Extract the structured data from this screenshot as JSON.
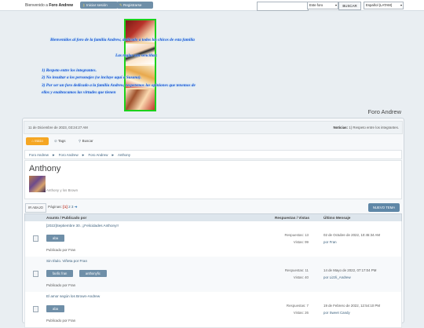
{
  "topbar": {
    "welcome_prefix": "Bienvenido a",
    "welcome_forum": "Foro Andrew",
    "login_label": "Iniciar sesión",
    "register_label": "Registrarse",
    "search_placeholder": "",
    "scope_value": "Este foro",
    "search_button": "BUSCAR",
    "language_value": "Español (LATAM)"
  },
  "banner": {
    "line1": "Bienvenidos al foro de la familia Andrew, dedicado a todos los chicos de esta familia",
    "line2": "Las reglas son sencillas:",
    "line3": "1) Respeto entre los integrantes.",
    "line4": "2) No insultar a los personajes (se incluye aquí a Susana).",
    "line5": "3) Por ser un foro dedicado a la familia Andrew, respetemos las opiniones que tenemos de",
    "line6": "ellos y enaltezcamos las virtudes que tienen",
    "forum_name": "Foro Andrew"
  },
  "info": {
    "date": "11 de Diciembre de 2023, 03:24:27 AM",
    "news_label": "Noticias:",
    "news_text": "1) Respeto entre los integrantes."
  },
  "menu": {
    "home": "Inicio",
    "tags": "Tags",
    "search": "Buscar"
  },
  "breadcrumb": [
    "Foro Andrew",
    "Foro Andrew",
    "Foro Andrew",
    "Anthony"
  ],
  "board": {
    "title": "Anthony",
    "description": "Anthony y los Brown"
  },
  "pagination": {
    "down_label": "IR ABAJO",
    "pages_label": "Páginas:",
    "current": "[1]",
    "page2": "2",
    "page3": "3",
    "next_arrow": "➜",
    "new_topic": "NUEVO TEMA"
  },
  "table": {
    "col_subject": "Asunto / Publicado por",
    "col_replies": "Respuestas / Vistas",
    "col_last": "Último Mensaje",
    "rows": [
      {
        "subject": "[2022]Septiembre 30. ¡¡Felicidades Anthony!!",
        "tags": [
          "aba"
        ],
        "starter": "Publicado por Fran",
        "replies": "Respuestas: 13",
        "views": "Vistas: 99",
        "last_date": "02 de Octubre de 2022, 10:45:34 AM",
        "last_by": "por Fran"
      },
      {
        "subject": "Sin título. Viñeta por Fran",
        "tags": [
          "fanfic fran",
          "anthonyfic"
        ],
        "starter": "Publicado por Fran",
        "replies": "Respuestas: 11",
        "views": "Vistas: 40",
        "last_date": "14 de Mayo de 2022, 07:17:04 PM",
        "last_by": "por Lizzli_Andrew"
      },
      {
        "subject": "El amor según los Brown-Andrew",
        "tags": [
          "aba"
        ],
        "starter": "Publicado por Fran",
        "replies": "Respuestas: 7",
        "views": "Vistas: 26",
        "last_date": "19 de Febrero de 2022, 12:54:10 PM",
        "last_by": "por Sweet Candy"
      }
    ]
  }
}
